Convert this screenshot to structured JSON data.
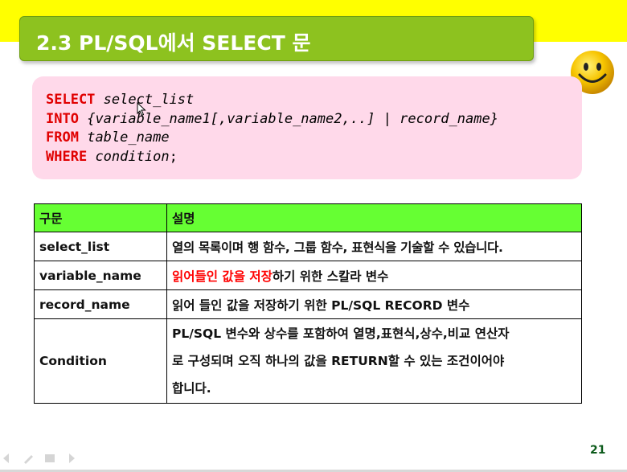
{
  "slide": {
    "title": "2.3 PL/SQL에서 SELECT 문",
    "page_number": "21"
  },
  "syntax": {
    "line1_kw": "SELECT",
    "line1_arg": "select_list",
    "line2_kw": "INTO",
    "line2_arg": "{variable_name1[,variable_name2,..] | record_name}",
    "line3_kw": "FROM",
    "line3_arg": "table_name",
    "line4_kw": "WHERE",
    "line4_arg": "condition",
    "line4_end": ";"
  },
  "table": {
    "headers": [
      "구문",
      "설명"
    ],
    "rows": [
      {
        "term": "select_list",
        "desc": "열의 목록이며 행 함수, 그룹 함수, 표현식을 기술할 수 있습니다."
      },
      {
        "term": "variable_name",
        "desc_red": "읽어들인 값을 저장",
        "desc_rest": "하기 위한 스칼라 변수"
      },
      {
        "term": "record_name",
        "desc": "읽어 들인 값을 저장하기 위한 PL/SQL RECORD 변수"
      },
      {
        "term": "Condition",
        "desc_lines": [
          "PL/SQL 변수와 상수를 포함하여 열명,표현식,상수,비교 연산자",
          "로 구성되며 오직 하나의 값을 RETURN할 수 있는 조건이어야",
          "합니다."
        ]
      }
    ]
  },
  "colors": {
    "title_bg": "#8dc21f",
    "top_band": "#ffff00",
    "code_bg": "#ffd9ea",
    "keyword": "#e00000",
    "table_header_bg": "#66ff33"
  },
  "icons": [
    "smiley-icon",
    "mouse-cursor-icon",
    "nav-prev-icon",
    "nav-annotate-icon",
    "nav-menu-icon",
    "nav-next-icon"
  ]
}
